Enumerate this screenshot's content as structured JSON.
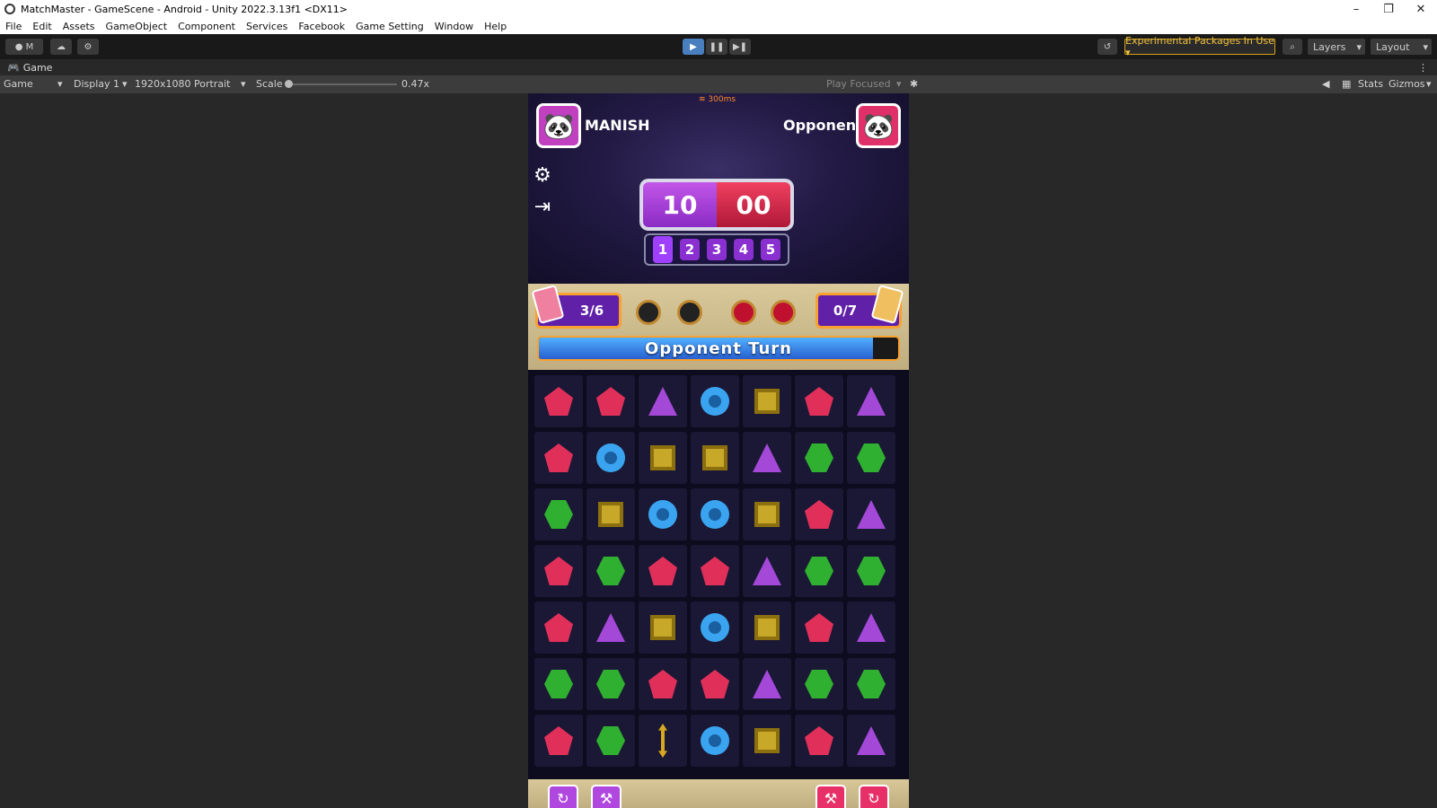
{
  "window": {
    "title": "MatchMaster - GameScene - Android - Unity 2022.3.13f1 <DX11>",
    "minimize": "–",
    "maximize": "❐",
    "close": "✕"
  },
  "menu": [
    "File",
    "Edit",
    "Assets",
    "GameObject",
    "Component",
    "Services",
    "Facebook",
    "Game Setting",
    "Window",
    "Help"
  ],
  "toolbar": {
    "account": "M",
    "play": "▶",
    "pause": "❚❚",
    "step": "▶❚",
    "experimental": "Experimental Packages In Use ▾",
    "layers": "Layers",
    "layout": "Layout"
  },
  "game_tab": {
    "label": "Game"
  },
  "game_bar": {
    "view": "Game",
    "display": "Display 1",
    "resolution": "1920x1080 Portrait",
    "scale_label": "Scale",
    "scale_value": "0.47x",
    "play_focused": "Play Focused",
    "stats": "Stats",
    "gizmos": "Gizmos"
  },
  "game": {
    "ping": "300ms",
    "player_name": "MANISH",
    "opponent_name": "Opponent",
    "score_player": "10",
    "score_opponent": "00",
    "rounds": [
      "1",
      "2",
      "3",
      "4",
      "5"
    ],
    "current_round": 1,
    "player_moves": "3/6",
    "opponent_moves": "0/7",
    "turn_text": "Opponent Turn",
    "turn_progress": 0.93,
    "dots": [
      "dark",
      "dark",
      "red",
      "red"
    ],
    "board": [
      [
        "red",
        "red",
        "purple",
        "blue",
        "yellow",
        "red",
        "purple"
      ],
      [
        "red",
        "blue",
        "yellow",
        "yellow",
        "purple",
        "green",
        "green"
      ],
      [
        "green",
        "yellow",
        "blue",
        "blue",
        "yellow",
        "red",
        "purple"
      ],
      [
        "red",
        "green",
        "red",
        "red",
        "purple",
        "green",
        "green"
      ],
      [
        "red",
        "purple",
        "yellow",
        "blue",
        "yellow",
        "red",
        "purple"
      ],
      [
        "green",
        "green",
        "red",
        "red",
        "purple",
        "green",
        "green"
      ],
      [
        "red",
        "green",
        "arrow",
        "blue",
        "yellow",
        "red",
        "purple"
      ]
    ],
    "icons": {
      "settings": "gear-icon",
      "exit": "exit-icon",
      "avatar": "panda-icon"
    }
  }
}
